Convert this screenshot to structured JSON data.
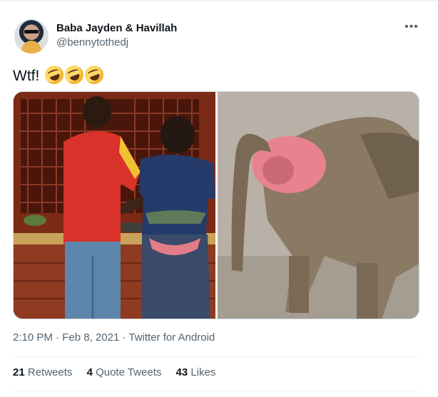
{
  "author": {
    "name": "Baba Jayden & Havillah",
    "handle": "@bennytothedj",
    "avatar_icon": "profile-avatar"
  },
  "more_label": "•••",
  "tweet": {
    "text": "Wtf!",
    "emoji_icon": "rolling-on-floor-laughing-emoji",
    "emoji_count": 3
  },
  "media": [
    {
      "icon": "photo-couple-at-market-stall"
    },
    {
      "icon": "photo-baboon-rear-view"
    }
  ],
  "meta": {
    "time": "2:10 PM",
    "sep1": "·",
    "date": "Feb 8, 2021",
    "sep2": "·",
    "source": "Twitter for Android"
  },
  "stats": {
    "retweets_count": "21",
    "retweets_label": "Retweets",
    "quotes_count": "4",
    "quotes_label": "Quote Tweets",
    "likes_count": "43",
    "likes_label": "Likes"
  },
  "colors": {
    "text_primary": "#0f1419",
    "text_secondary": "#536471",
    "divider": "#eff3f4"
  }
}
